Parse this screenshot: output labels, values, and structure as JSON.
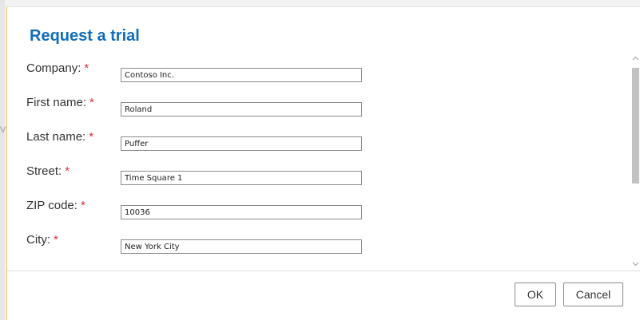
{
  "background": {
    "fragment_text": "V"
  },
  "dialog": {
    "title": "Request a trial",
    "required_marker": "*",
    "fields": [
      {
        "label": "Company:",
        "value": "Contoso Inc."
      },
      {
        "label": "First name:",
        "value": "Roland"
      },
      {
        "label": "Last name:",
        "value": "Puffer"
      },
      {
        "label": "Street:",
        "value": "Time Square 1"
      },
      {
        "label": "ZIP code:",
        "value": "10036"
      },
      {
        "label": "City:",
        "value": "New York City"
      }
    ],
    "buttons": {
      "ok_label": "OK",
      "cancel_label": "Cancel"
    }
  },
  "colors": {
    "title": "#106ebe",
    "required": "#d13438",
    "dialog_accent_border": "#e8c25a"
  },
  "icons": {
    "scroll_up": "chevron-up-icon",
    "scroll_down": "chevron-down-icon"
  }
}
